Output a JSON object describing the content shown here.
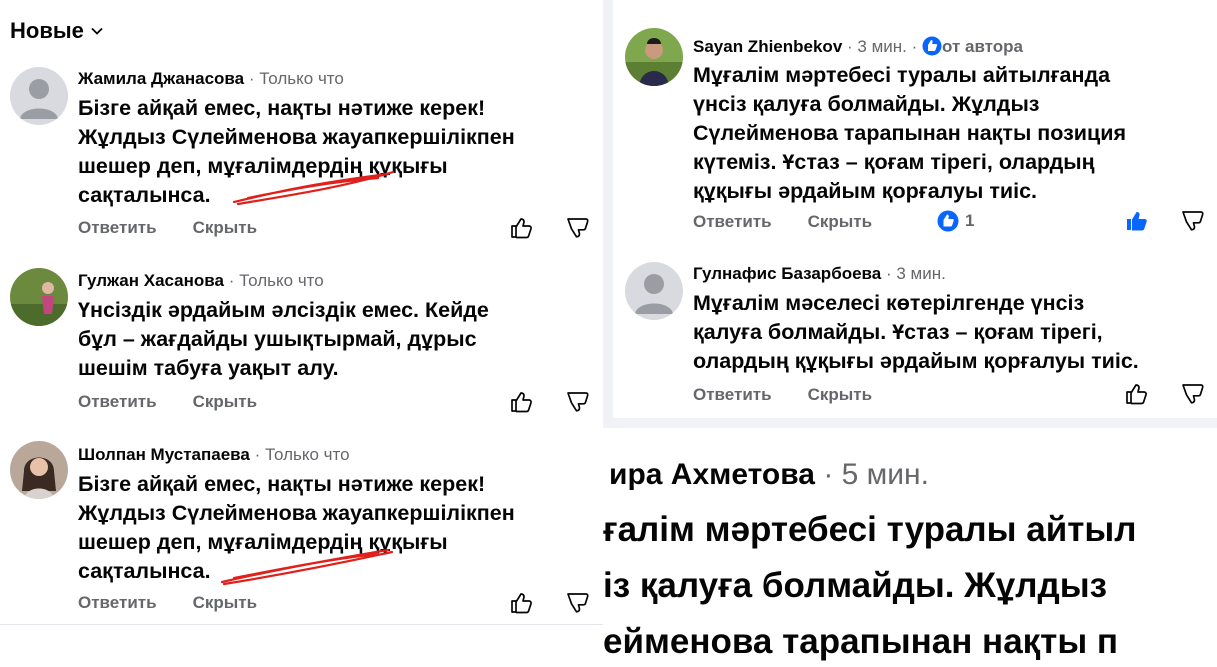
{
  "sort": {
    "label": "Новые"
  },
  "actions": {
    "reply": "Ответить",
    "hide": "Скрыть"
  },
  "left_comments": [
    {
      "author": "Жамила Джанасова",
      "time": "Только что",
      "lines": [
        "Бізге айқай емес, нақты нәтиже керек!",
        "Жұлдыз Сүлейменова жауапкершілікпен",
        "шешер деп, мұғалімдердің құқығы",
        "сақталынса."
      ]
    },
    {
      "author": "Гулжан Хасанова",
      "time": "Только что",
      "lines": [
        "Үнсіздік әрдайым әлсіздік емес. Кейде",
        "бұл – жағдайды ушықтырмай, дұрыс",
        "шешім табуға уақыт алу."
      ]
    },
    {
      "author": "Шолпан Мустапаева",
      "time": "Только что",
      "lines": [
        "Бізге айқай емес, нақты нәтиже керек!",
        "Жұлдыз Сүлейменова жауапкершілікпен",
        "шешер деп, мұғалімдердің құқығы",
        "сақталынса."
      ]
    }
  ],
  "right_comments": [
    {
      "author": "Sayan Zhienbekov",
      "time": "3 мин.",
      "badge": "от автора",
      "lines": [
        "Мұғалім мәртебесі туралы айтылғанда",
        "үнсіз қалуға болмайды. Жұлдыз",
        "Сүлейменова тарапынан нақты позиция",
        "күтеміз. Ұстаз – қоғам тірегі, олардың",
        "құқығы әрдайым қорғалуы тиіс."
      ],
      "reactions": "1"
    },
    {
      "author": "Гулнафис Базарбоева",
      "time": "3 мин.",
      "lines": [
        "Мұғалім мәселесі көтерілгенде үнсіз",
        "қалуға болмайды. Ұстаз – қоғам тірегі,",
        "олардың құқығы әрдайым қорғалуы тиіс."
      ]
    }
  ],
  "zoomed": {
    "author": "ира Ахметова",
    "time": "5 мин.",
    "lines": [
      "ғалім мәртебесі туралы айтыл",
      "із қалуға болмайды. Жұлдыз",
      "ейменова тарапынан нақты п"
    ]
  },
  "colors": {
    "accent": "#0866ff",
    "secondary_text": "#65676b",
    "scribble": "#e0201a",
    "separator": "#f0f2f5"
  }
}
